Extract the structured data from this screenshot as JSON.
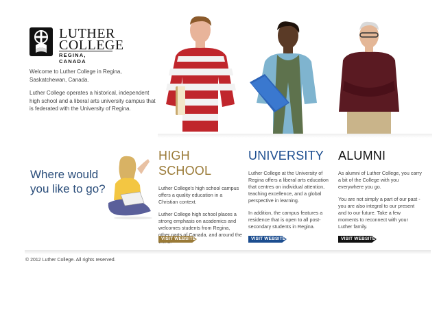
{
  "logo": {
    "line1": "LUTHER",
    "line2": "COLLEGE",
    "line3": "REGINA, CANADA"
  },
  "intro": {
    "p1": "Welcome to Luther College in Regina, Saskatchewan, Canada.",
    "p2": "Luther College operates a historical, independent high school and a liberal arts university campus that is federated with the University of Regina."
  },
  "prompt": {
    "line1": "Where would",
    "line2": "you like to go?"
  },
  "columns": [
    {
      "title": "HIGH SCHOOL",
      "color": "#9a7a37",
      "p1": "Luther College's high school campus offers a quality education in a Christian context.",
      "p2": "Luther College high school places a strong emphasis on academics and welcomes students from Regina, other parts of Canada, and around the world.",
      "button": "VISIT WEBSITE"
    },
    {
      "title": "UNIVERSITY",
      "color": "#1c4d8f",
      "p1": "Luther College at the University of Regina offers a liberal arts education that centres on individual attention, teaching excellence, and a global perspective in learning.",
      "p2": "In addition, the campus features a residence that is open to all post-secondary students in Regina.",
      "button": "VISIT WEBSITE"
    },
    {
      "title": "ALUMNI",
      "color": "#111111",
      "p1": "As alumni of Luther College, you carry a bit of the College with you everywhere you go.",
      "p2": "You are not simply a part of our past - you are also integral to our present and to our future. Take a few moments to reconnect with your Luther family.",
      "button": "VISIT WEBSITE"
    }
  ],
  "footer": {
    "copyright": "© 2012 Luther College. All rights reserved."
  }
}
